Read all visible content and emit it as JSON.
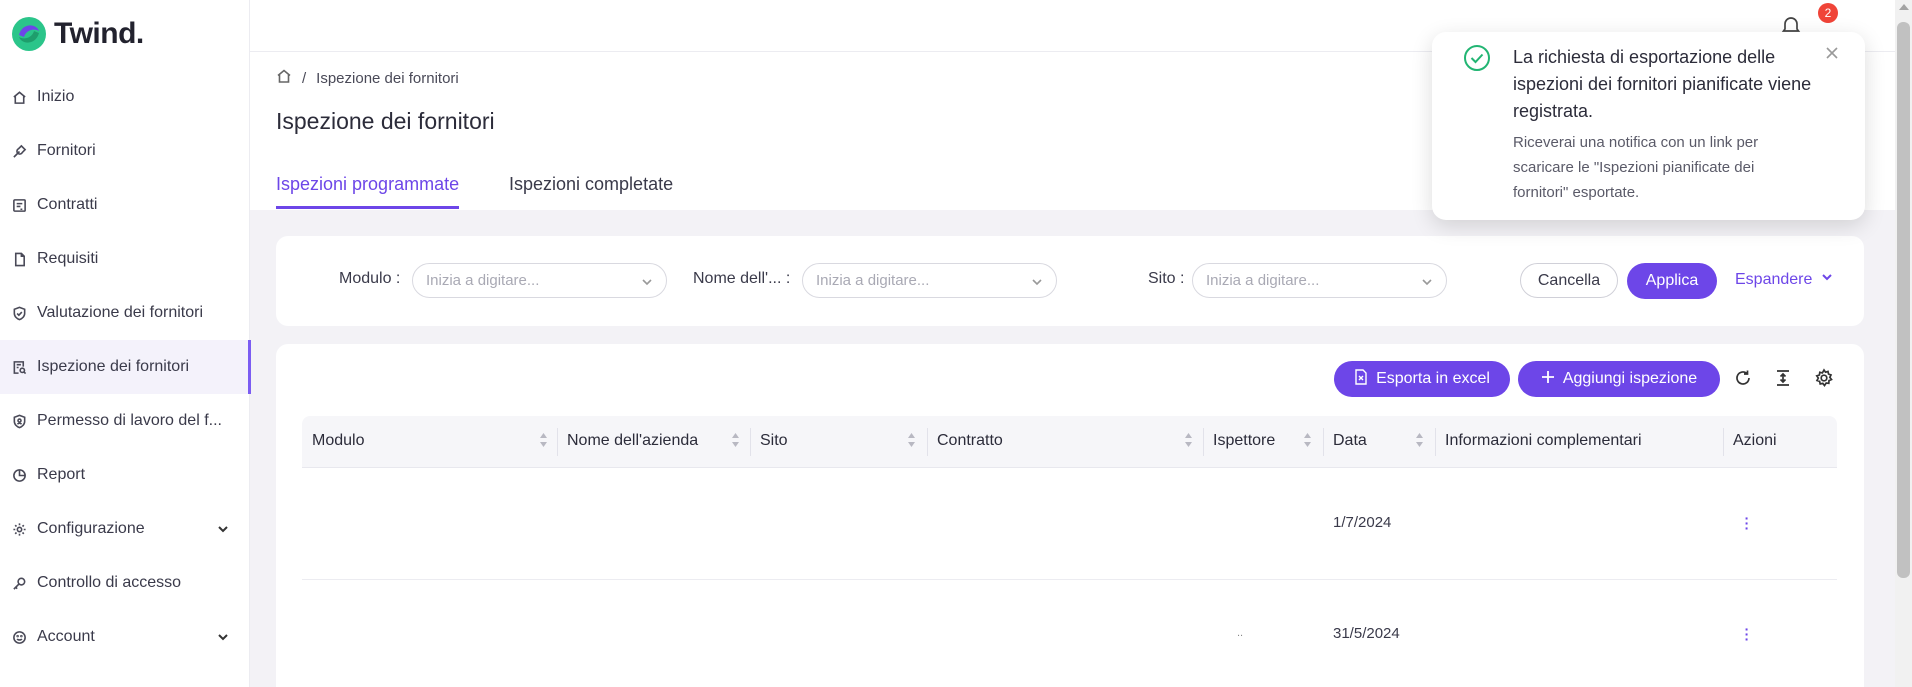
{
  "brand": {
    "name": "Twind.",
    "accent": "#6d46e8",
    "logo_green": "#2bc58a"
  },
  "sidebar": {
    "items": [
      {
        "label": "Inizio",
        "icon": "home-icon"
      },
      {
        "label": "Fornitori",
        "icon": "wrench-icon"
      },
      {
        "label": "Contratti",
        "icon": "contract-icon"
      },
      {
        "label": "Requisiti",
        "icon": "document-icon"
      },
      {
        "label": "Valutazione dei fornitori",
        "icon": "shield-check-icon"
      },
      {
        "label": "Ispezione dei fornitori",
        "icon": "inspection-icon",
        "active": true
      },
      {
        "label": "Permesso di lavoro del f...",
        "icon": "permit-icon"
      },
      {
        "label": "Report",
        "icon": "pie-chart-icon"
      },
      {
        "label": "Configurazione",
        "icon": "gear-icon",
        "expandable": true
      },
      {
        "label": "Controllo di accesso",
        "icon": "key-icon"
      },
      {
        "label": "Account",
        "icon": "smile-icon",
        "expandable": true
      }
    ]
  },
  "topbar": {
    "notification_count": "2"
  },
  "breadcrumb": {
    "current": "Ispezione dei fornitori",
    "separator": "/"
  },
  "page": {
    "title": "Ispezione dei fornitori"
  },
  "tabs": [
    {
      "label": "Ispezioni programmate",
      "active": true
    },
    {
      "label": "Ispezioni completate",
      "active": false
    }
  ],
  "filters": {
    "modulo_label": "Modulo",
    "azienda_label": "Nome dell'...",
    "sito_label": "Sito",
    "placeholder": "Inizia a digitare...",
    "cancel": "Cancella",
    "apply": "Applica",
    "expand": "Espandere"
  },
  "toolbar": {
    "export": "Esporta in excel",
    "add": "Aggiungi ispezione"
  },
  "table": {
    "columns": [
      "Modulo",
      "Nome dell'azienda",
      "Sito",
      "Contratto",
      "Ispettore",
      "Data",
      "Informazioni complementari",
      "Azioni"
    ],
    "rows": [
      {
        "modulo": "",
        "azienda": "",
        "sito": "",
        "contratto": "",
        "ispettore": "",
        "data": "1/7/2024",
        "info": ""
      },
      {
        "modulo": "",
        "azienda": "",
        "sito": "",
        "contratto": "",
        "ispettore": "..",
        "data": "31/5/2024",
        "info": ""
      }
    ]
  },
  "toast": {
    "title": "La richiesta di esportazione delle ispezioni dei fornitori pianificate viene registrata.",
    "body": "Riceverai una notifica con un link per scaricare le \"Ispezioni pianificate dei fornitori\" esportate."
  }
}
